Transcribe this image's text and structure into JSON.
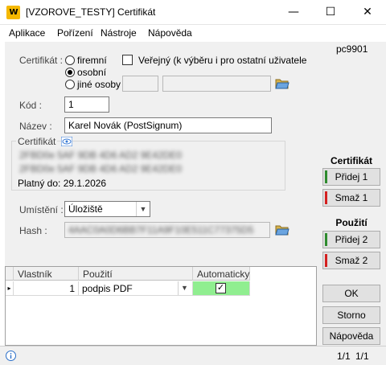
{
  "window": {
    "title": "[VZOROVE_TESTY] Certifikát",
    "logo_text": "W",
    "controls": {
      "minimize": "—",
      "maximize": "☐",
      "close": "✕"
    }
  },
  "menu": [
    "Aplikace",
    "Pořízení",
    "Nástroje",
    "Nápověda"
  ],
  "form": {
    "cert_type_label": "Certifikát :",
    "radio_firm": "firemní",
    "radio_personal": "osobní",
    "radio_other": "jiné osoby",
    "selected_type": "osobní",
    "public_label": "Veřejný (k výběru i pro ostatní uživatele",
    "public_checked": false,
    "code_label": "Kód :",
    "code_value": "1",
    "name_label": "Název :",
    "name_value": "Karel Novák (PostSignum)",
    "cert_group_label": "Certifikát",
    "cert_line1": "2FBD0e 5AF 9DB 4D6 AD2 9E42DE0",
    "cert_line2": "2FBD0e 5AF 9DB 4D6 AD2 9E42DE0",
    "valid_until": "Platný do: 29.1.2026",
    "location_label": "Umístění :",
    "location_value": "Úložiště",
    "hash_label": "Hash :",
    "hash_value": "4AAC0A0D6BB7F11A9F10E511C77375D5"
  },
  "sidebar": {
    "user_code": "pc9901",
    "cert_heading": "Certifikát",
    "cert_add": "Přidej 1",
    "cert_delete": "Smaž 1",
    "usage_heading": "Použití",
    "usage_add": "Přidej 2",
    "usage_delete": "Smaž 2",
    "ok": "OK",
    "cancel": "Storno",
    "help": "Nápověda"
  },
  "grid": {
    "columns": [
      "Vlastník",
      "Použití",
      "Automaticky"
    ],
    "rows": [
      {
        "owner": "1",
        "usage": "podpis PDF",
        "automatic": true
      }
    ]
  },
  "status": {
    "info_icon": "info-icon",
    "record": "1/1",
    "total": "1/1"
  },
  "colors": {
    "logo": "#f5b800",
    "auto_cell": "#90ee90",
    "add_bar": "#2e8b2e",
    "delete_bar": "#d42020"
  }
}
